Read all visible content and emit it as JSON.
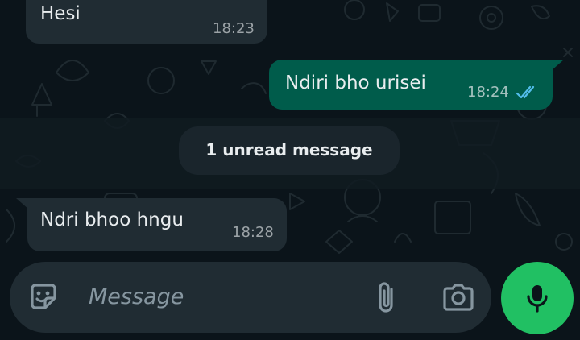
{
  "messages": [
    {
      "direction": "incoming",
      "text": "Hesi",
      "time": "18:23"
    },
    {
      "direction": "outgoing",
      "text": "Ndiri bho urisei",
      "time": "18:24",
      "status": "read"
    },
    {
      "direction": "incoming",
      "text": "Ndri bhoo hngu",
      "time": "18:28"
    }
  ],
  "unread_banner": {
    "label": "1 unread message"
  },
  "composer": {
    "placeholder": "Message",
    "emoji_icon": "sticker-icon",
    "attach_icon": "paperclip-icon",
    "camera_icon": "camera-icon",
    "send_icon": "microphone-icon"
  },
  "colors": {
    "background": "#0b141a",
    "incoming_bubble": "#202c33",
    "outgoing_bubble": "#005c4b",
    "read_ticks": "#53bdeb",
    "mic_button": "#21c063"
  }
}
